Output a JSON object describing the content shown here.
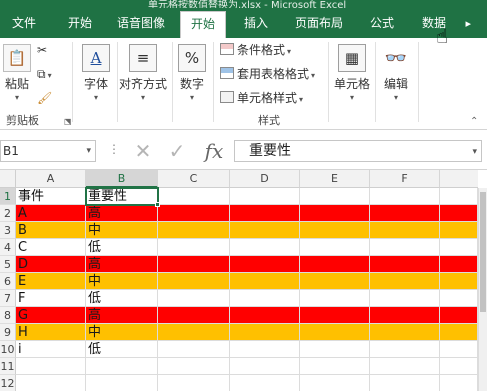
{
  "window": {
    "title": "单元格按数值替换为.xlsx - Microsoft Excel"
  },
  "tabs": [
    {
      "label": "文件"
    },
    {
      "label": "开始"
    },
    {
      "label": "语音图像"
    },
    {
      "label": "插入"
    },
    {
      "label": "页面布局"
    },
    {
      "label": "公式"
    },
    {
      "label": "数据"
    }
  ],
  "ribbon": {
    "clipboard": {
      "paste": "粘贴",
      "label": "剪贴板"
    },
    "font": {
      "label": "字体"
    },
    "alignment": {
      "label": "对齐方式"
    },
    "number": {
      "label": "数字"
    },
    "styles": {
      "conditional_format": "条件格式",
      "format_as_table": "套用表格格式",
      "cell_styles": "单元格样式",
      "label": "样式"
    },
    "cells": {
      "label": "单元格"
    },
    "editing": {
      "label": "编辑"
    }
  },
  "formula_bar": {
    "name_box": "B1",
    "cancel_icon": "✕",
    "enter_icon": "✓",
    "fx": "fx",
    "content": "重要性"
  },
  "grid": {
    "columns": [
      "A",
      "B",
      "C",
      "D",
      "E",
      "F"
    ],
    "rows": [
      "1",
      "2",
      "3",
      "4",
      "5",
      "6",
      "7",
      "8",
      "9",
      "10",
      "11",
      "12"
    ],
    "cells": [
      {
        "row": 1,
        "a": "事件",
        "b": "重要性",
        "fill": "none"
      },
      {
        "row": 2,
        "a": "A",
        "b": "高",
        "fill": "red"
      },
      {
        "row": 3,
        "a": "B",
        "b": "中",
        "fill": "orange"
      },
      {
        "row": 4,
        "a": "C",
        "b": "低",
        "fill": "none"
      },
      {
        "row": 5,
        "a": "D",
        "b": "高",
        "fill": "red"
      },
      {
        "row": 6,
        "a": "E",
        "b": "中",
        "fill": "orange"
      },
      {
        "row": 7,
        "a": "F",
        "b": "低",
        "fill": "none"
      },
      {
        "row": 8,
        "a": "G",
        "b": "高",
        "fill": "red"
      },
      {
        "row": 9,
        "a": "H",
        "b": "中",
        "fill": "orange"
      },
      {
        "row": 10,
        "a": "i",
        "b": "低",
        "fill": "none"
      }
    ],
    "selected_cell": "B1"
  },
  "colors": {
    "excel_green": "#217346",
    "high": "#ff0000",
    "medium": "#ffc000"
  },
  "icons": [
    "cut-icon",
    "copy-icon",
    "format-painter-icon",
    "font-icon",
    "align-icon",
    "percent-icon",
    "conditional-format-icon",
    "table-format-icon",
    "cell-style-icon",
    "cells-icon",
    "find-icon",
    "hand-cursor-icon"
  ]
}
